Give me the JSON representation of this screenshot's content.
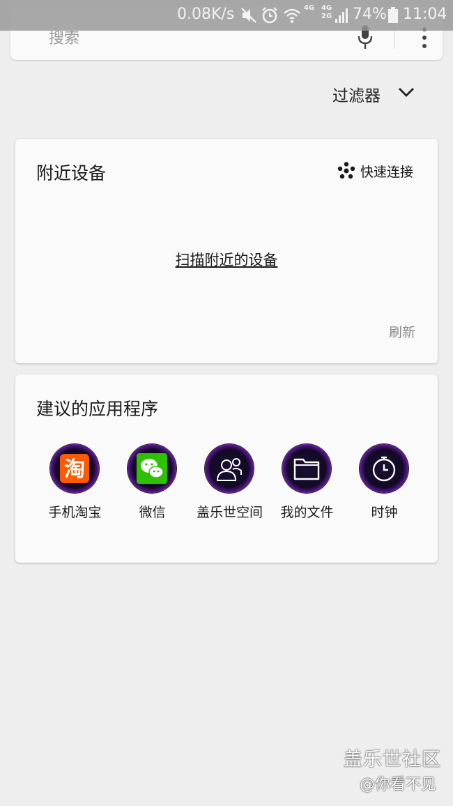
{
  "status_bar": {
    "speed": "0.08K/s",
    "net_a_top": "4G",
    "net_b_top": "4G",
    "net_b_bottom": "2G",
    "battery": "74%",
    "time": "11:04"
  },
  "search": {
    "placeholder": "搜索"
  },
  "filter": {
    "label": "过滤器"
  },
  "nearby": {
    "title": "附近设备",
    "quick_connect": "快速连接",
    "scan": "扫描附近的设备",
    "refresh": "刷新"
  },
  "apps": {
    "title": "建议的应用程序",
    "items": [
      {
        "label": "手机淘宝",
        "icon": "taobao-icon"
      },
      {
        "label": "微信",
        "icon": "wechat-icon"
      },
      {
        "label": "盖乐世空间",
        "icon": "galaxy-space-icon"
      },
      {
        "label": "我的文件",
        "icon": "folder-icon"
      },
      {
        "label": "时钟",
        "icon": "clock-icon"
      }
    ]
  },
  "watermark": {
    "line1": "盖乐世社区",
    "line2": "@你看不见"
  },
  "colors": {
    "background": "#eeeeee",
    "card": "#fafafa",
    "taobao": "#ff5a00",
    "wechat": "#2dc100"
  }
}
